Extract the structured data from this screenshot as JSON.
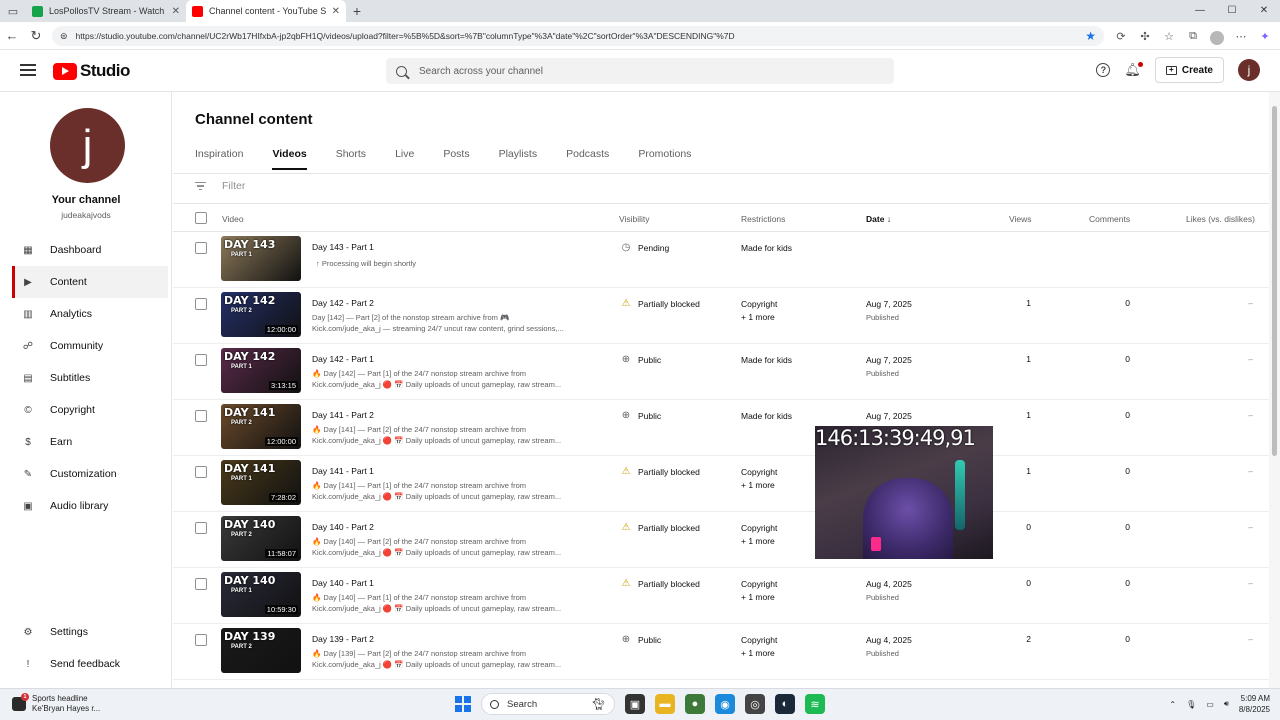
{
  "browser": {
    "tabs": [
      {
        "title": "LosPollosTV Stream - Watch Live",
        "color": "#17a34a",
        "active": false
      },
      {
        "title": "Channel content - YouTube Studio",
        "color": "#ff0000",
        "active": true
      }
    ],
    "url": "https://studio.youtube.com/channel/UC2rWb17HIfxbA-jp2qbFH1Q/videos/upload?filter=%5B%5D&sort=%7B\"columnType\"%3A\"date\"%2C\"sortOrder\"%3A\"DESCENDING\"%7D"
  },
  "header": {
    "logo_text": "Studio",
    "search_placeholder": "Search across your channel",
    "create_label": "Create",
    "avatar_letter": "j"
  },
  "sidebar": {
    "avatar_letter": "j",
    "channel_title": "Your channel",
    "channel_handle": "judeakajvods",
    "items": [
      {
        "label": "Dashboard",
        "icon": "dashboard-icon",
        "glyph": "▦"
      },
      {
        "label": "Content",
        "icon": "content-icon",
        "glyph": "▶",
        "active": true
      },
      {
        "label": "Analytics",
        "icon": "analytics-icon",
        "glyph": "▥"
      },
      {
        "label": "Community",
        "icon": "community-icon",
        "glyph": "☍"
      },
      {
        "label": "Subtitles",
        "icon": "subtitles-icon",
        "glyph": "▤"
      },
      {
        "label": "Copyright",
        "icon": "copyright-icon",
        "glyph": "©"
      },
      {
        "label": "Earn",
        "icon": "earn-icon",
        "glyph": "$"
      },
      {
        "label": "Customization",
        "icon": "customization-icon",
        "glyph": "✎"
      },
      {
        "label": "Audio library",
        "icon": "audio-library-icon",
        "glyph": "▣"
      }
    ],
    "bottom": [
      {
        "label": "Settings",
        "icon": "settings-icon",
        "glyph": "⚙"
      },
      {
        "label": "Send feedback",
        "icon": "feedback-icon",
        "glyph": "!"
      }
    ]
  },
  "main": {
    "title": "Channel content",
    "tabs": [
      "Inspiration",
      "Videos",
      "Shorts",
      "Live",
      "Posts",
      "Playlists",
      "Podcasts",
      "Promotions"
    ],
    "active_tab": "Videos",
    "filter_label": "Filter",
    "columns": {
      "video": "Video",
      "visibility": "Visibility",
      "restrictions": "Restrictions",
      "date": "Date",
      "views": "Views",
      "comments": "Comments",
      "likes": "Likes (vs. dislikes)"
    }
  },
  "rows": [
    {
      "title": "Day 143 - Part 1",
      "desc1": "Processing will begin shortly",
      "desc2": "",
      "visibility": "Pending",
      "vis_icon": "clock-icon",
      "restriction": "Made for kids",
      "restriction_more": "",
      "date": "",
      "date_status": "",
      "views": "",
      "comments": "",
      "likes": "",
      "thumb_day": "DAY 143",
      "thumb_part": "PART 1",
      "duration": "",
      "thumb_color": "#8d7a5a"
    },
    {
      "title": "Day 142 - Part 2",
      "desc1": "Day [142] — Part [2] of the nonstop stream archive from 🎮",
      "desc2": "Kick.com/jude_aka_j — streaming 24/7 uncut raw content, grind sessions,...",
      "visibility": "Partially blocked",
      "vis_icon": "warning-icon",
      "restriction": "Copyright",
      "restriction_more": "+ 1 more",
      "date": "Aug 7, 2025",
      "date_status": "Published",
      "views": "1",
      "comments": "0",
      "likes": "–",
      "thumb_day": "DAY 142",
      "thumb_part": "PART 2",
      "duration": "12:00:00",
      "thumb_color": "#24306a"
    },
    {
      "title": "Day 142 - Part 1",
      "desc1": "🔥 Day [142] — Part [1] of the 24/7 nonstop stream archive from",
      "desc2": "Kick.com/jude_aka_j 🔴 📅 Daily uploads of uncut gameplay, raw stream...",
      "visibility": "Public",
      "vis_icon": "globe-icon",
      "restriction": "Made for kids",
      "restriction_more": "",
      "date": "Aug 7, 2025",
      "date_status": "Published",
      "views": "1",
      "comments": "0",
      "likes": "–",
      "thumb_day": "DAY 142",
      "thumb_part": "PART 1",
      "duration": "3:13:15",
      "thumb_color": "#5a2a4a"
    },
    {
      "title": "Day 141 - Part 2",
      "desc1": "🔥 Day [141] — Part [2] of the 24/7 nonstop stream archive from",
      "desc2": "Kick.com/jude_aka_j 🔴 📅 Daily uploads of uncut gameplay, raw stream...",
      "visibility": "Public",
      "vis_icon": "globe-icon",
      "restriction": "Made for kids",
      "restriction_more": "",
      "date": "Aug 7, 2025",
      "date_status": "",
      "views": "1",
      "comments": "0",
      "likes": "–",
      "thumb_day": "DAY 141",
      "thumb_part": "PART 2",
      "duration": "12:00:00",
      "thumb_color": "#6b4a2a"
    },
    {
      "title": "Day 141 - Part 1",
      "desc1": "🔥 Day [141] — Part [1] of the 24/7 nonstop stream archive from",
      "desc2": "Kick.com/jude_aka_j 🔴 📅 Daily uploads of uncut gameplay, raw stream...",
      "visibility": "Partially blocked",
      "vis_icon": "warning-icon",
      "restriction": "Copyright",
      "restriction_more": "+ 1 more",
      "date": "",
      "date_status": "",
      "views": "1",
      "comments": "0",
      "likes": "–",
      "thumb_day": "DAY 141",
      "thumb_part": "PART 1",
      "duration": "7:28:02",
      "thumb_color": "#4a3a1a"
    },
    {
      "title": "Day 140 - Part 2",
      "desc1": "🔥 Day [140] — Part [2] of the 24/7 nonstop stream archive from",
      "desc2": "Kick.com/jude_aka_j 🔴 📅 Daily uploads of uncut gameplay, raw stream...",
      "visibility": "Partially blocked",
      "vis_icon": "warning-icon",
      "restriction": "Copyright",
      "restriction_more": "+ 1 more",
      "date": "",
      "date_status": "",
      "views": "0",
      "comments": "0",
      "likes": "–",
      "thumb_day": "DAY 140",
      "thumb_part": "PART 2",
      "duration": "11:58:07",
      "thumb_color": "#3a3a3a"
    },
    {
      "title": "Day 140 - Part 1",
      "desc1": "🔥 Day [140] — Part [1] of the 24/7 nonstop stream archive from",
      "desc2": "Kick.com/jude_aka_j 🔴 📅 Daily uploads of uncut gameplay, raw stream...",
      "visibility": "Partially blocked",
      "vis_icon": "warning-icon",
      "restriction": "Copyright",
      "restriction_more": "+ 1 more",
      "date": "Aug 4, 2025",
      "date_status": "Published",
      "views": "0",
      "comments": "0",
      "likes": "–",
      "thumb_day": "DAY 140",
      "thumb_part": "PART 1",
      "duration": "10:59:30",
      "thumb_color": "#2a2a3a"
    },
    {
      "title": "Day 139 - Part 2",
      "desc1": "🔥 Day [139] — Part [2] of the 24/7 nonstop stream archive from",
      "desc2": "Kick.com/jude_aka_j 🔴 📅 Daily uploads of uncut gameplay, raw stream...",
      "visibility": "Public",
      "vis_icon": "globe-icon",
      "restriction": "Copyright",
      "restriction_more": "+ 1 more",
      "date": "Aug 4, 2025",
      "date_status": "Published",
      "views": "2",
      "comments": "0",
      "likes": "–",
      "thumb_day": "DAY 139",
      "thumb_part": "PART 2",
      "duration": "",
      "thumb_color": "#1a1a1a"
    }
  ],
  "overlay": {
    "counter": "146:13:39:49,91"
  },
  "taskbar": {
    "news_title": "Sports headline",
    "news_sub": "Ke'Bryan Hayes r...",
    "news_badge": "1",
    "search_label": "Search",
    "time": "5:09 AM",
    "date": "8/8/2025"
  }
}
